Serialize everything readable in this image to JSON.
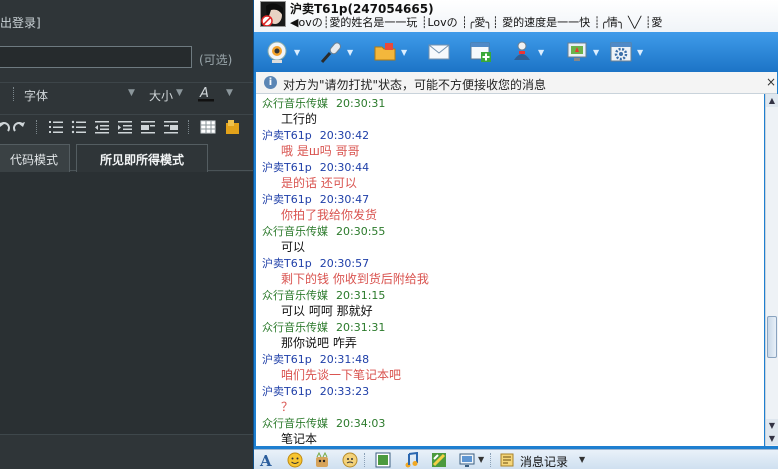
{
  "left_panel": {
    "logout_text": "出登录]",
    "optional_label": "(可选)",
    "font_label": "字体",
    "size_label": "大小",
    "tabs": [
      {
        "label": "代码模式",
        "active": false
      },
      {
        "label": "所见即所得模式",
        "active": true
      }
    ]
  },
  "chat": {
    "contact_name": "沪卖T61p(247054665)",
    "signature": "◀ovの┊愛的姓名是一一玩  ┊Lovの  ┊╭愛╮┊ 愛的速度是一一快  ┊╭情╮  ╲╱  ┊愛",
    "notice_text": "对方为\"请勿打扰\"状态，可能不方便接收您的消息",
    "notice_close": "×",
    "messages": [
      {
        "sender": "众行音乐传媒",
        "time": "20:30:31",
        "text": "工行的",
        "side": "them"
      },
      {
        "sender": "沪卖T61p",
        "time": "20:30:42",
        "text": "哦 是ш吗 哥哥",
        "side": "me"
      },
      {
        "sender": "沪卖T61p",
        "time": "20:30:44",
        "text": "是的话 还可以",
        "side": "me"
      },
      {
        "sender": "沪卖T61p",
        "time": "20:30:47",
        "text": "你拍了我给你发货",
        "side": "me"
      },
      {
        "sender": "众行音乐传媒",
        "time": "20:30:55",
        "text": "可以",
        "side": "them"
      },
      {
        "sender": "沪卖T61p",
        "time": "20:30:57",
        "text": "剩下的钱 你收到货后附给我",
        "side": "me"
      },
      {
        "sender": "众行音乐传媒",
        "time": "20:31:15",
        "text": "可以   呵呵    那就好",
        "side": "them"
      },
      {
        "sender": "众行音乐传媒",
        "time": "20:31:31",
        "text": "那你说吧   咋弄",
        "side": "them"
      },
      {
        "sender": "沪卖T61p",
        "time": "20:31:48",
        "text": "咱们先谈一下笔记本吧",
        "side": "me"
      },
      {
        "sender": "沪卖T61p",
        "time": "20:33:23",
        "text": "？",
        "side": "me"
      },
      {
        "sender": "众行音乐传媒",
        "time": "20:34:03",
        "text": "笔记本",
        "side": "them"
      }
    ],
    "history_label": "消息记录",
    "scroll_position": 0.7,
    "colors": {
      "toolbar": "#1e7fd0",
      "sender_them": "#2b7a2b",
      "sender_me": "#1f3fa8",
      "text_me": "#d9534f"
    }
  }
}
